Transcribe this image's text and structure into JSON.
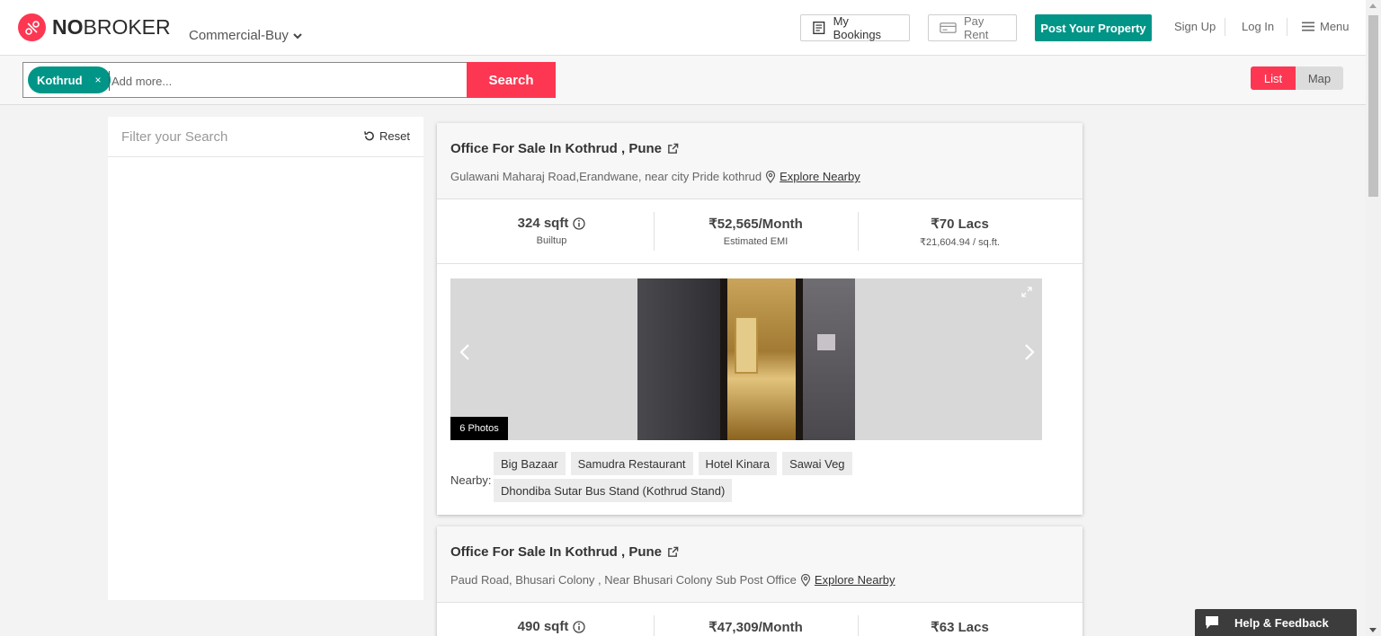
{
  "header": {
    "logo_bold": "NO",
    "logo_light": "BROKER",
    "category": "Commercial-Buy",
    "my_bookings": "My Bookings",
    "pay_rent": "Pay Rent",
    "post_property": "Post Your Property",
    "sign_up": "Sign Up",
    "log_in": "Log In",
    "menu": "Menu"
  },
  "search": {
    "chip": "Kothrud",
    "chip_close": "×",
    "placeholder": "Add more...",
    "button": "Search"
  },
  "view_toggle": {
    "list": "List",
    "map": "Map",
    "active": "List"
  },
  "filter": {
    "title": "Filter your Search",
    "reset": "Reset"
  },
  "listings": [
    {
      "title": "Office For Sale In Kothrud , Pune",
      "address": "Gulawani Maharaj Road,Erandwane, near city Pride kothrud",
      "explore": "Explore Nearby",
      "area": "324 sqft",
      "area_label": "Builtup",
      "emi": "₹52,565/Month",
      "emi_label": "Estimated EMI",
      "price": "₹70 Lacs",
      "price_per_sqft": "₹21,604.94 / sq.ft.",
      "photos": "6 Photos",
      "nearby_label": "Nearby:",
      "nearby": [
        "Big Bazaar",
        "Samudra Restaurant",
        "Hotel Kinara",
        "Sawai Veg",
        "Dhondiba Sutar Bus Stand (Kothrud Stand)"
      ]
    },
    {
      "title": "Office For Sale In Kothrud , Pune",
      "address": "Paud Road, Bhusari Colony , Near Bhusari Colony Sub Post Office",
      "explore": "Explore Nearby",
      "area": "490 sqft",
      "emi": "₹47,309/Month",
      "price": "₹63 Lacs"
    }
  ],
  "help": {
    "label": "Help & Feedback"
  },
  "colors": {
    "brand": "#fd3752",
    "accent": "#009587"
  }
}
